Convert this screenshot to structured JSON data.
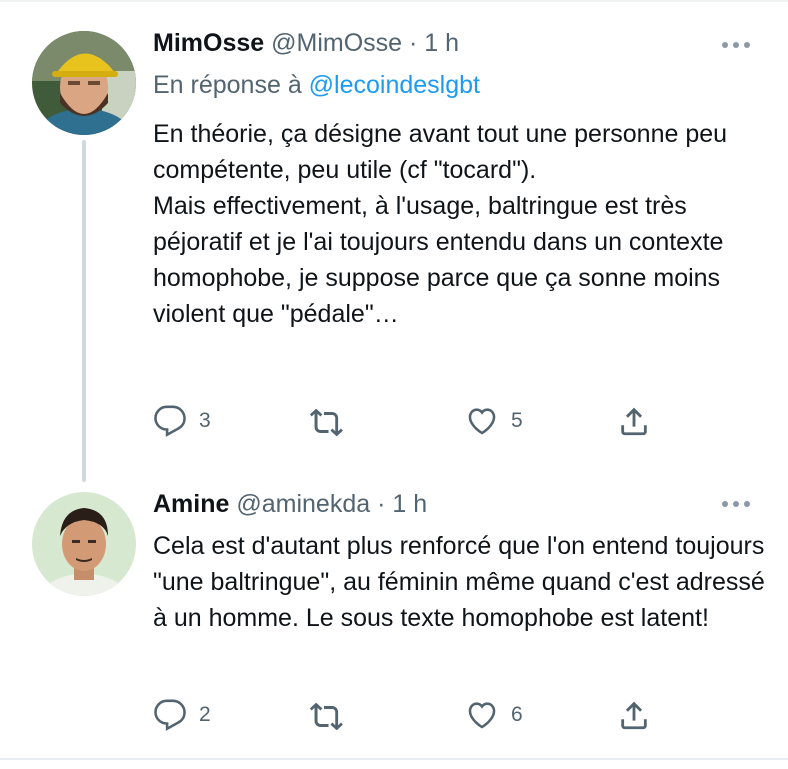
{
  "tweets": [
    {
      "name": "MimOsse",
      "handle": "@MimOsse",
      "separator": "·",
      "time": "1 h",
      "reply_prefix": "En réponse à ",
      "reply_mention": "@lecoindeslgbt",
      "text_p1": "En théorie, ça désigne avant tout une personne peu compétente, peu utile (cf \"tocard\").",
      "text_p2": "Mais effectivement, à l'usage, baltringue est très péjoratif et je l'ai toujours entendu dans un contexte homophobe, je suppose parce que ça sonne moins violent que \"pédale\"…",
      "reply_count": "3",
      "retweet_count": "",
      "like_count": "5"
    },
    {
      "name": "Amine",
      "handle": "@aminekda",
      "separator": "·",
      "time": "1 h",
      "text_p1": "Cela est d'autant plus renforcé que l'on entend toujours \"une baltringue\", au féminin même quand c'est adressé à un homme. Le sous texte homophobe est latent!",
      "reply_count": "2",
      "retweet_count": "",
      "like_count": "6"
    }
  ],
  "colors": {
    "text": "#0f1419",
    "secondary": "#536471",
    "link": "#1d9bf0",
    "thread_line": "#cfd9de"
  },
  "icons": [
    "more-icon",
    "reply-icon",
    "retweet-icon",
    "like-icon",
    "share-icon"
  ]
}
